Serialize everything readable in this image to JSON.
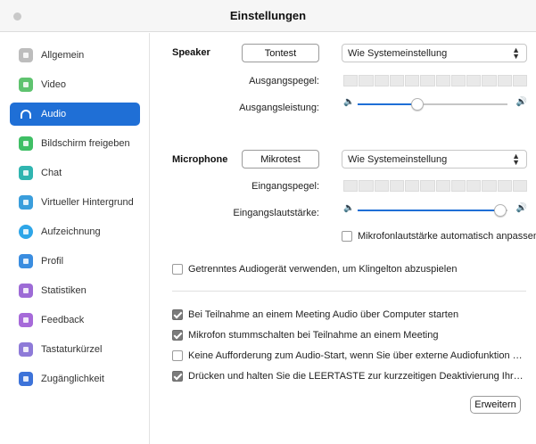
{
  "window": {
    "title": "Einstellungen"
  },
  "sidebar": {
    "items": [
      {
        "label": "Allgemein",
        "icon": "gear-icon",
        "color": "#bdbdbd",
        "active": false
      },
      {
        "label": "Video",
        "icon": "video-camera-icon",
        "color": "#5fc36f",
        "active": false
      },
      {
        "label": "Audio",
        "icon": "headphones-icon",
        "color": "#1f6fd6",
        "active": true
      },
      {
        "label": "Bildschirm freigeben",
        "icon": "share-screen-icon",
        "color": "#3fbf65",
        "active": false
      },
      {
        "label": "Chat",
        "icon": "chat-icon",
        "color": "#30b5b0",
        "active": false
      },
      {
        "label": "Virtueller Hintergrund",
        "icon": "virtual-background-icon",
        "color": "#3a9edc",
        "active": false
      },
      {
        "label": "Aufzeichnung",
        "icon": "recording-icon",
        "color": "#2ea6e8",
        "active": false
      },
      {
        "label": "Profil",
        "icon": "profile-icon",
        "color": "#3a8de0",
        "active": false
      },
      {
        "label": "Statistiken",
        "icon": "statistics-icon",
        "color": "#9d6bd6",
        "active": false
      },
      {
        "label": "Feedback",
        "icon": "feedback-icon",
        "color": "#a66ad9",
        "active": false
      },
      {
        "label": "Tastaturkürzel",
        "icon": "keyboard-icon",
        "color": "#8e7ad8",
        "active": false
      },
      {
        "label": "Zugänglichkeit",
        "icon": "accessibility-icon",
        "color": "#3d73d9",
        "active": false
      }
    ]
  },
  "speaker": {
    "heading": "Speaker",
    "test_button": "Tontest",
    "device": "Wie Systemeinstellung",
    "output_level_label": "Ausgangspegel:",
    "output_volume_label": "Ausgangsleistung:",
    "output_volume": 0.4,
    "output_level_segments": 12
  },
  "microphone": {
    "heading": "Microphone",
    "test_button": "Mikrotest",
    "device": "Wie Systemeinstellung",
    "input_level_label": "Eingangspegel:",
    "input_volume_label": "Eingangslautstärke:",
    "input_volume": 0.95,
    "input_level_segments": 12,
    "auto_adjust_label": "Mikrofonlautstärke automatisch anpassen",
    "auto_adjust_checked": false
  },
  "separate_device": {
    "label": "Getrenntes Audiogerät verwenden, um Klingelton abzuspielen",
    "checked": false
  },
  "options": [
    {
      "label": "Bei Teilnahme an einem Meeting Audio über Computer starten",
      "checked": true
    },
    {
      "label": "Mikrofon stummschalten bei Teilnahme an einem Meeting",
      "checked": true
    },
    {
      "label": "Keine Aufforderung zum Audio-Start, wenn Sie über externe Audiofunktion an eine...",
      "checked": false
    },
    {
      "label": "Drücken und halten Sie die LEERTASTE zur kurzzeitigen Deaktivierung Ihrer Stum...",
      "checked": true
    }
  ],
  "advanced_button": "Erweitern",
  "colors": {
    "accent": "#1f6fd6"
  }
}
